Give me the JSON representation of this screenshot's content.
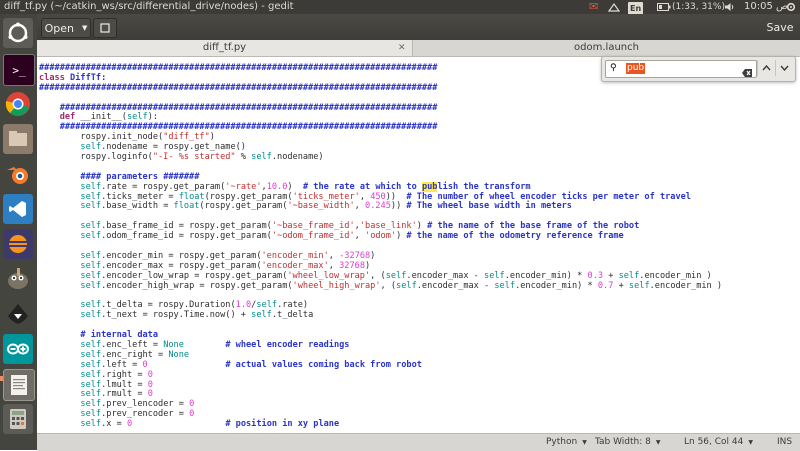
{
  "system_panel": {
    "window_title": "diff_tf.py (~/catkin_ws/src/differential_drive/nodes) - gedit",
    "keyboard_layout": "En",
    "battery": "(1:33, 31%)",
    "clock": "10:05 ص",
    "icons": [
      "envelope-icon",
      "network-icon",
      "bluetooth-icon",
      "keyboard-icon",
      "battery-icon",
      "volume-icon",
      "gear-icon"
    ]
  },
  "launcher": {
    "items": [
      "dash-icon",
      "terminal-icon",
      "chrome-icon",
      "files-icon",
      "blender-icon",
      "vscode-icon",
      "eclipse-icon",
      "gimp-icon",
      "inkscape-icon",
      "arduino-icon",
      "gedit-icon",
      "calculator-icon"
    ]
  },
  "header": {
    "open_label": "Open",
    "save_label": "Save"
  },
  "tabs": [
    {
      "label": "diff_tf.py"
    },
    {
      "label": "odom.launch"
    }
  ],
  "search": {
    "value": "pub"
  },
  "code_lines": [
    [
      {
        "t": "#############################################################################",
        "c": "cm"
      }
    ],
    [
      {
        "t": "class ",
        "c": "kw"
      },
      {
        "t": "DiffTf:",
        "c": "cm"
      }
    ],
    [
      {
        "t": "#############################################################################",
        "c": "cm"
      }
    ],
    [
      {
        "t": "",
        "c": ""
      }
    ],
    [
      {
        "t": "    ",
        "c": ""
      },
      {
        "t": "#########################################################################",
        "c": "cm"
      }
    ],
    [
      {
        "t": "    ",
        "c": ""
      },
      {
        "t": "def",
        "c": "kw"
      },
      {
        "t": " __init__(",
        "c": ""
      },
      {
        "t": "self",
        "c": "sf"
      },
      {
        "t": "):",
        "c": ""
      }
    ],
    [
      {
        "t": "    ",
        "c": ""
      },
      {
        "t": "#########################################################################",
        "c": "cm"
      }
    ],
    [
      {
        "t": "        rospy.init_node(",
        "c": ""
      },
      {
        "t": "\"diff_tf\"",
        "c": "st"
      },
      {
        "t": ")",
        "c": ""
      }
    ],
    [
      {
        "t": "        ",
        "c": ""
      },
      {
        "t": "self",
        "c": "sf"
      },
      {
        "t": ".nodename = rospy.get_name()",
        "c": ""
      }
    ],
    [
      {
        "t": "        rospy.loginfo(",
        "c": ""
      },
      {
        "t": "\"-I- %s started\"",
        "c": "st"
      },
      {
        "t": " % ",
        "c": ""
      },
      {
        "t": "self",
        "c": "sf"
      },
      {
        "t": ".nodename)",
        "c": ""
      }
    ],
    [
      {
        "t": "",
        "c": ""
      }
    ],
    [
      {
        "t": "        ",
        "c": ""
      },
      {
        "t": "#### parameters #######",
        "c": "cm"
      }
    ],
    [
      {
        "t": "        ",
        "c": ""
      },
      {
        "t": "self",
        "c": "sf"
      },
      {
        "t": ".rate = rospy.get_param(",
        "c": ""
      },
      {
        "t": "'~rate'",
        "c": "st"
      },
      {
        "t": ",",
        "c": ""
      },
      {
        "t": "10.0",
        "c": "nu"
      },
      {
        "t": ")  ",
        "c": ""
      },
      {
        "t": "# the rate at which to ",
        "c": "cm"
      },
      {
        "t": "pub",
        "c": "cm hl"
      },
      {
        "t": "lish the transform",
        "c": "cm"
      }
    ],
    [
      {
        "t": "        ",
        "c": ""
      },
      {
        "t": "self",
        "c": "sf"
      },
      {
        "t": ".ticks_meter = ",
        "c": ""
      },
      {
        "t": "float",
        "c": "sf"
      },
      {
        "t": "(rospy.get_param(",
        "c": ""
      },
      {
        "t": "'ticks_meter'",
        "c": "st"
      },
      {
        "t": ", ",
        "c": ""
      },
      {
        "t": "450",
        "c": "nu"
      },
      {
        "t": "))  ",
        "c": ""
      },
      {
        "t": "# The number of wheel encoder ticks per meter of travel",
        "c": "cm"
      }
    ],
    [
      {
        "t": "        ",
        "c": ""
      },
      {
        "t": "self",
        "c": "sf"
      },
      {
        "t": ".base_width = ",
        "c": ""
      },
      {
        "t": "float",
        "c": "sf"
      },
      {
        "t": "(rospy.get_param(",
        "c": ""
      },
      {
        "t": "'~base_width'",
        "c": "st"
      },
      {
        "t": ", ",
        "c": ""
      },
      {
        "t": "0.245",
        "c": "nu"
      },
      {
        "t": ")) ",
        "c": ""
      },
      {
        "t": "# The wheel base width in meters",
        "c": "cm"
      }
    ],
    [
      {
        "t": "",
        "c": ""
      }
    ],
    [
      {
        "t": "        ",
        "c": ""
      },
      {
        "t": "self",
        "c": "sf"
      },
      {
        "t": ".base_frame_id = rospy.get_param(",
        "c": ""
      },
      {
        "t": "'~base_frame_id'",
        "c": "st"
      },
      {
        "t": ",",
        "c": ""
      },
      {
        "t": "'base_link'",
        "c": "st"
      },
      {
        "t": ") ",
        "c": ""
      },
      {
        "t": "# the name of the base frame of the robot",
        "c": "cm"
      }
    ],
    [
      {
        "t": "        ",
        "c": ""
      },
      {
        "t": "self",
        "c": "sf"
      },
      {
        "t": ".odom_frame_id = rospy.get_param(",
        "c": ""
      },
      {
        "t": "'~odom_frame_id'",
        "c": "st"
      },
      {
        "t": ", ",
        "c": ""
      },
      {
        "t": "'odom'",
        "c": "st"
      },
      {
        "t": ") ",
        "c": ""
      },
      {
        "t": "# the name of the odometry reference frame",
        "c": "cm"
      }
    ],
    [
      {
        "t": "",
        "c": ""
      }
    ],
    [
      {
        "t": "        ",
        "c": ""
      },
      {
        "t": "self",
        "c": "sf"
      },
      {
        "t": ".encoder_min = rospy.get_param(",
        "c": ""
      },
      {
        "t": "'encoder_min'",
        "c": "st"
      },
      {
        "t": ", ",
        "c": ""
      },
      {
        "t": "-32768",
        "c": "nu"
      },
      {
        "t": ")",
        "c": ""
      }
    ],
    [
      {
        "t": "        ",
        "c": ""
      },
      {
        "t": "self",
        "c": "sf"
      },
      {
        "t": ".encoder_max = rospy.get_param(",
        "c": ""
      },
      {
        "t": "'encoder_max'",
        "c": "st"
      },
      {
        "t": ", ",
        "c": ""
      },
      {
        "t": "32768",
        "c": "nu"
      },
      {
        "t": ")",
        "c": ""
      }
    ],
    [
      {
        "t": "        ",
        "c": ""
      },
      {
        "t": "self",
        "c": "sf"
      },
      {
        "t": ".encoder_low_wrap = rospy.get_param(",
        "c": ""
      },
      {
        "t": "'wheel_low_wrap'",
        "c": "st"
      },
      {
        "t": ", (",
        "c": ""
      },
      {
        "t": "self",
        "c": "sf"
      },
      {
        "t": ".encoder_max - ",
        "c": ""
      },
      {
        "t": "self",
        "c": "sf"
      },
      {
        "t": ".encoder_min) * ",
        "c": ""
      },
      {
        "t": "0.3",
        "c": "nu"
      },
      {
        "t": " + ",
        "c": ""
      },
      {
        "t": "self",
        "c": "sf"
      },
      {
        "t": ".encoder_min )",
        "c": ""
      }
    ],
    [
      {
        "t": "        ",
        "c": ""
      },
      {
        "t": "self",
        "c": "sf"
      },
      {
        "t": ".encoder_high_wrap = rospy.get_param(",
        "c": ""
      },
      {
        "t": "'wheel_high_wrap'",
        "c": "st"
      },
      {
        "t": ", (",
        "c": ""
      },
      {
        "t": "self",
        "c": "sf"
      },
      {
        "t": ".encoder_max - ",
        "c": ""
      },
      {
        "t": "self",
        "c": "sf"
      },
      {
        "t": ".encoder_min) * ",
        "c": ""
      },
      {
        "t": "0.7",
        "c": "nu"
      },
      {
        "t": " + ",
        "c": ""
      },
      {
        "t": "self",
        "c": "sf"
      },
      {
        "t": ".encoder_min )",
        "c": ""
      }
    ],
    [
      {
        "t": "",
        "c": ""
      }
    ],
    [
      {
        "t": "        ",
        "c": ""
      },
      {
        "t": "self",
        "c": "sf"
      },
      {
        "t": ".t_delta = rospy.Duration(",
        "c": ""
      },
      {
        "t": "1.0",
        "c": "nu"
      },
      {
        "t": "/",
        "c": ""
      },
      {
        "t": "self",
        "c": "sf"
      },
      {
        "t": ".rate)",
        "c": ""
      }
    ],
    [
      {
        "t": "        ",
        "c": ""
      },
      {
        "t": "self",
        "c": "sf"
      },
      {
        "t": ".t_next = rospy.Time.now() + ",
        "c": ""
      },
      {
        "t": "self",
        "c": "sf"
      },
      {
        "t": ".t_delta",
        "c": ""
      }
    ],
    [
      {
        "t": "",
        "c": ""
      }
    ],
    [
      {
        "t": "        ",
        "c": ""
      },
      {
        "t": "# internal data",
        "c": "cm"
      }
    ],
    [
      {
        "t": "        ",
        "c": ""
      },
      {
        "t": "self",
        "c": "sf"
      },
      {
        "t": ".enc_left = ",
        "c": ""
      },
      {
        "t": "None",
        "c": "sf"
      },
      {
        "t": "        ",
        "c": ""
      },
      {
        "t": "# wheel encoder readings",
        "c": "cm"
      }
    ],
    [
      {
        "t": "        ",
        "c": ""
      },
      {
        "t": "self",
        "c": "sf"
      },
      {
        "t": ".enc_right = ",
        "c": ""
      },
      {
        "t": "None",
        "c": "sf"
      }
    ],
    [
      {
        "t": "        ",
        "c": ""
      },
      {
        "t": "self",
        "c": "sf"
      },
      {
        "t": ".left = ",
        "c": ""
      },
      {
        "t": "0",
        "c": "nu"
      },
      {
        "t": "               ",
        "c": ""
      },
      {
        "t": "# actual values coming back from robot",
        "c": "cm"
      }
    ],
    [
      {
        "t": "        ",
        "c": ""
      },
      {
        "t": "self",
        "c": "sf"
      },
      {
        "t": ".right = ",
        "c": ""
      },
      {
        "t": "0",
        "c": "nu"
      }
    ],
    [
      {
        "t": "        ",
        "c": ""
      },
      {
        "t": "self",
        "c": "sf"
      },
      {
        "t": ".lmult = ",
        "c": ""
      },
      {
        "t": "0",
        "c": "nu"
      }
    ],
    [
      {
        "t": "        ",
        "c": ""
      },
      {
        "t": "self",
        "c": "sf"
      },
      {
        "t": ".rmult = ",
        "c": ""
      },
      {
        "t": "0",
        "c": "nu"
      }
    ],
    [
      {
        "t": "        ",
        "c": ""
      },
      {
        "t": "self",
        "c": "sf"
      },
      {
        "t": ".prev_lencoder = ",
        "c": ""
      },
      {
        "t": "0",
        "c": "nu"
      }
    ],
    [
      {
        "t": "        ",
        "c": ""
      },
      {
        "t": "self",
        "c": "sf"
      },
      {
        "t": ".prev_rencoder = ",
        "c": ""
      },
      {
        "t": "0",
        "c": "nu"
      }
    ],
    [
      {
        "t": "        ",
        "c": ""
      },
      {
        "t": "self",
        "c": "sf"
      },
      {
        "t": ".x = ",
        "c": ""
      },
      {
        "t": "0",
        "c": "nu"
      },
      {
        "t": "                  ",
        "c": ""
      },
      {
        "t": "# position in xy plane",
        "c": "cm"
      }
    ]
  ],
  "status": {
    "language": "Python",
    "tab_width": "Tab Width: 8",
    "position": "Ln 56, Col 44",
    "mode": "INS"
  }
}
